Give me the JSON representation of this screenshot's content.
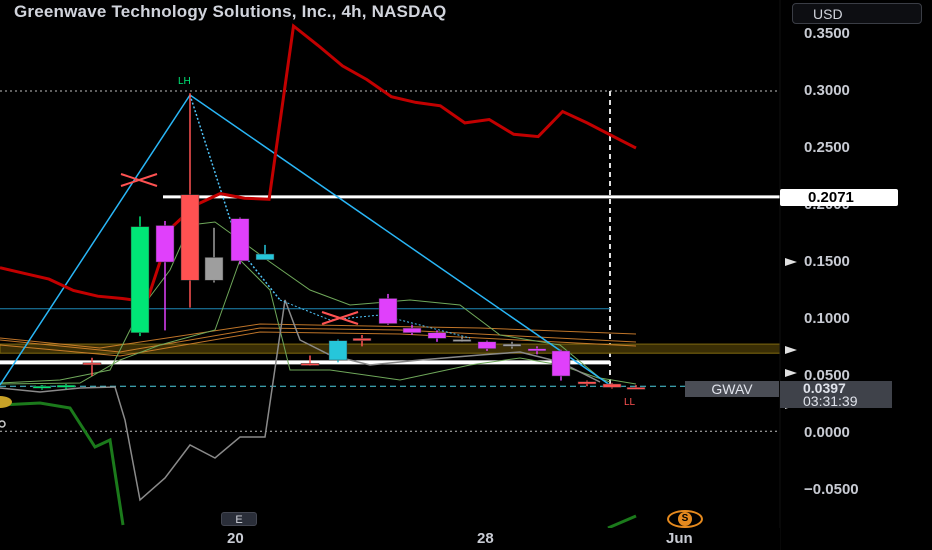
{
  "header": {
    "title": "Greenwave Technology Solutions, Inc., 4h, NASDAQ",
    "currency": "USD"
  },
  "price_axis": {
    "ticks": [
      "0.3500",
      "0.3000",
      "0.2500",
      "0.2000",
      "0.1500",
      "0.1000",
      "0.0500",
      "0.0000",
      "−0.0500"
    ]
  },
  "tags": {
    "level_price": "0.2071",
    "symbol": "GWAV",
    "last_price": "0.0397",
    "countdown": "03:31:39"
  },
  "time_axis": {
    "labels": [
      "20",
      "28",
      "Jun"
    ]
  },
  "annotations": {
    "lower_high": "LH",
    "lower_low": "LL"
  },
  "events": {
    "earnings": "E",
    "split": "S"
  },
  "colors": {
    "bull_candle": "#00e676",
    "bear_candle": "#ff5252",
    "magenta_candle": "#e040fb",
    "grey_candle": "#9e9e9e",
    "teal_candle": "#26c6da",
    "red_line": "#c20000",
    "cyan_line": "#29b6f6",
    "orange_band": "#e08a30",
    "green_osc": "#1b7a1b"
  },
  "chart_data": {
    "type": "candlestick",
    "y_range": [
      -0.085,
      0.36
    ],
    "x_labels": [
      "20",
      "28",
      "Jun"
    ],
    "candles": [
      {
        "o": 0.0395,
        "h": 0.042,
        "l": 0.038,
        "c": 0.041,
        "color": "bull"
      },
      {
        "o": 0.04,
        "h": 0.043,
        "l": 0.0385,
        "c": 0.042,
        "color": "bull"
      },
      {
        "o": 0.0605,
        "h": 0.066,
        "l": 0.05,
        "c": 0.0615,
        "color": "bear"
      },
      {
        "o": 0.088,
        "h": 0.19,
        "l": 0.085,
        "c": 0.181,
        "color": "bull"
      },
      {
        "o": 0.15,
        "h": 0.186,
        "l": 0.09,
        "c": 0.182,
        "color": "magenta"
      },
      {
        "o": 0.209,
        "h": 0.298,
        "l": 0.11,
        "c": 0.134,
        "color": "bear"
      },
      {
        "o": 0.134,
        "h": 0.18,
        "l": 0.132,
        "c": 0.154,
        "color": "grey"
      },
      {
        "o": 0.188,
        "h": 0.189,
        "l": 0.148,
        "c": 0.151,
        "color": "magenta"
      },
      {
        "o": 0.157,
        "h": 0.165,
        "l": 0.152,
        "c": 0.152,
        "color": "teal"
      },
      {
        "o": 0.061,
        "h": 0.068,
        "l": 0.059,
        "c": 0.06,
        "color": "bear"
      },
      {
        "o": 0.064,
        "h": 0.082,
        "l": 0.062,
        "c": 0.081,
        "color": "teal"
      },
      {
        "o": 0.081,
        "h": 0.086,
        "l": 0.076,
        "c": 0.083,
        "color": "bear"
      },
      {
        "o": 0.096,
        "h": 0.122,
        "l": 0.095,
        "c": 0.118,
        "color": "magenta"
      },
      {
        "o": 0.092,
        "h": 0.095,
        "l": 0.086,
        "c": 0.088,
        "color": "magenta"
      },
      {
        "o": 0.088,
        "h": 0.09,
        "l": 0.08,
        "c": 0.083,
        "color": "magenta"
      },
      {
        "o": 0.082,
        "h": 0.084,
        "l": 0.08,
        "c": 0.081,
        "color": "grey"
      },
      {
        "o": 0.08,
        "h": 0.081,
        "l": 0.072,
        "c": 0.074,
        "color": "magenta"
      },
      {
        "o": 0.076,
        "h": 0.08,
        "l": 0.074,
        "c": 0.078,
        "color": "grey"
      },
      {
        "o": 0.074,
        "h": 0.076,
        "l": 0.069,
        "c": 0.072,
        "color": "magenta"
      },
      {
        "o": 0.072,
        "h": 0.073,
        "l": 0.046,
        "c": 0.05,
        "color": "magenta"
      },
      {
        "o": 0.045,
        "h": 0.046,
        "l": 0.041,
        "c": 0.043,
        "color": "bear"
      },
      {
        "o": 0.043,
        "h": 0.044,
        "l": 0.039,
        "c": 0.04,
        "color": "bear"
      },
      {
        "o": 0.04,
        "h": 0.042,
        "l": 0.039,
        "c": 0.0397,
        "color": "bear"
      }
    ],
    "red_line": [
      0.145,
      0.14,
      0.135,
      0.125,
      0.12,
      0.118,
      0.115,
      0.18,
      0.2,
      0.21,
      0.206,
      0.205,
      0.357,
      0.34,
      0.322,
      0.31,
      0.295,
      0.29,
      0.287,
      0.272,
      0.275,
      0.262,
      0.26,
      0.282,
      0.272,
      0.261,
      0.25
    ],
    "levels": {
      "white_top": 0.2071,
      "white_low": 0.062,
      "dotted_high": 0.3,
      "dotted_low": 0.0015,
      "teal_dashed": 0.041,
      "cyan_thin": 0.109,
      "yellow_box": [
        0.07,
        0.078
      ]
    }
  }
}
